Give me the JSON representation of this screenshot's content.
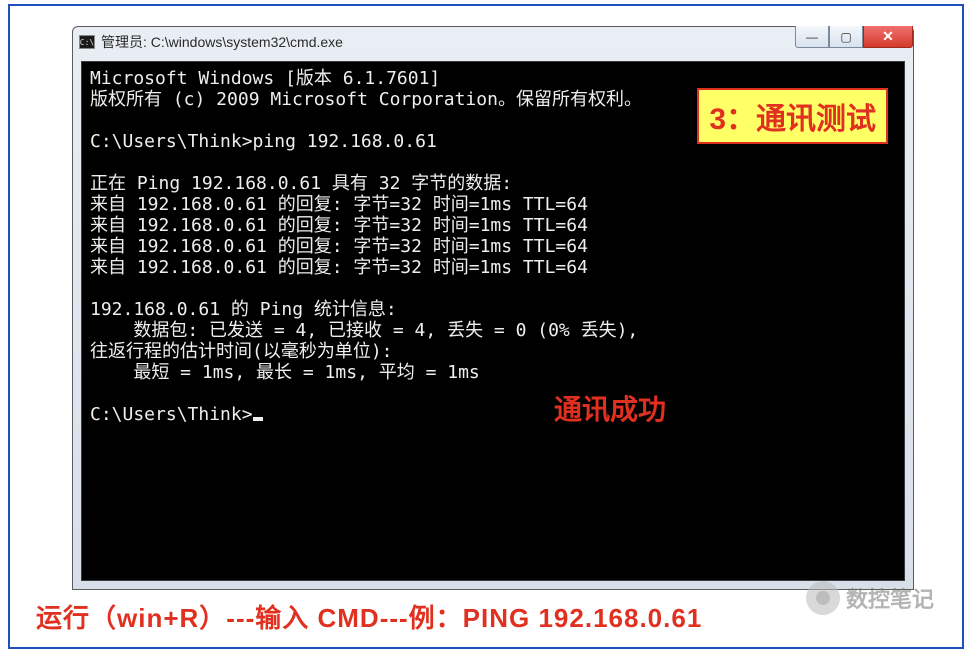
{
  "window": {
    "title": "管理员: C:\\windows\\system32\\cmd.exe",
    "sysicon": "C:\\",
    "min": "—",
    "max": "▢",
    "close": "✕"
  },
  "term": {
    "l0": "Microsoft Windows [版本 6.1.7601]",
    "l1": "版权所有 (c) 2009 Microsoft Corporation。保留所有权利。",
    "l2": "",
    "l3": "C:\\Users\\Think>ping 192.168.0.61",
    "l4": "",
    "l5": "正在 Ping 192.168.0.61 具有 32 字节的数据:",
    "l6": "来自 192.168.0.61 的回复: 字节=32 时间=1ms TTL=64",
    "l7": "来自 192.168.0.61 的回复: 字节=32 时间=1ms TTL=64",
    "l8": "来自 192.168.0.61 的回复: 字节=32 时间=1ms TTL=64",
    "l9": "来自 192.168.0.61 的回复: 字节=32 时间=1ms TTL=64",
    "l10": "",
    "l11": "192.168.0.61 的 Ping 统计信息:",
    "l12": "    数据包: 已发送 = 4, 已接收 = 4, 丢失 = 0 (0% 丢失),",
    "l13": "往返行程的估计时间(以毫秒为单位):",
    "l14": "    最短 = 1ms, 最长 = 1ms, 平均 = 1ms",
    "l15": "",
    "l16": "C:\\Users\\Think>"
  },
  "callout": {
    "num": "3",
    "sep": "：",
    "label": "通讯测试"
  },
  "success": "通讯成功",
  "bottom": "运行（win+R）---输入 CMD---例：PING 192.168.0.61",
  "watermark": "数控笔记"
}
